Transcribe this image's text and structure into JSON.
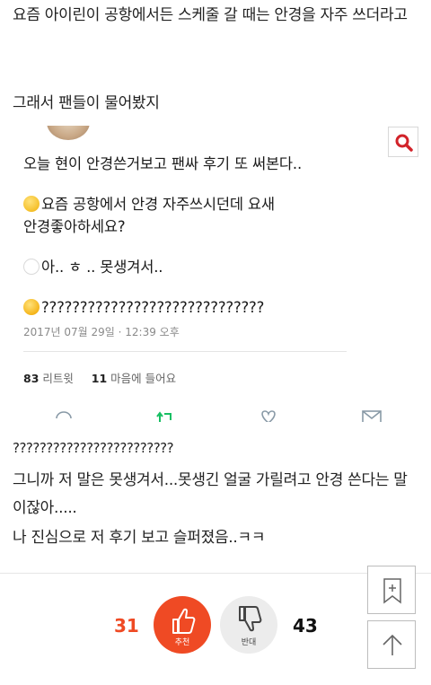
{
  "post": {
    "paragraph1": "요즘 아이린이 공항에서든 스케줄 갈 때는 안경을 자주 쓰더라고",
    "paragraph2": "그래서 팬들이 물어봤지",
    "after_lines": [
      "????????????????????????",
      "그니까 저 말은 못생겨서...못생긴 얼굴 가릴려고 안경 쓴다는 말이잖아.....",
      "나 진심으로 저 후기 보고 슬퍼졌음..ㅋㅋ"
    ]
  },
  "tweet": {
    "line1": "오늘 현이 안경쓴거보고 팬싸 후기 또 써본다..",
    "question_line1": "요즘 공항에서 안경 자주쓰시던데 요새",
    "question_line2": "안경좋아하세요?",
    "answer": "아.. ㅎ .. 못생겨서..",
    "reaction": "?????????????????????????????",
    "date": "2017년 07월 29일 · 12:39 오후",
    "retweet_count": "83",
    "retweet_label": "리트윗",
    "like_count": "11",
    "like_label": "마음에 들어요",
    "icons": [
      "search-icon",
      "reply-icon",
      "retweet-icon",
      "heart-icon",
      "message-icon"
    ],
    "accent_color": "#17bf63",
    "search_color": "#d2232a"
  },
  "reactions": {
    "recommend_count": "31",
    "recommend_label": "추천",
    "oppose_count": "43",
    "oppose_label": "반대",
    "recommend_color": "#ef4a24",
    "oppose_color": "#ececec"
  },
  "side_buttons": [
    "bookmark-icon",
    "scroll-top-icon"
  ]
}
